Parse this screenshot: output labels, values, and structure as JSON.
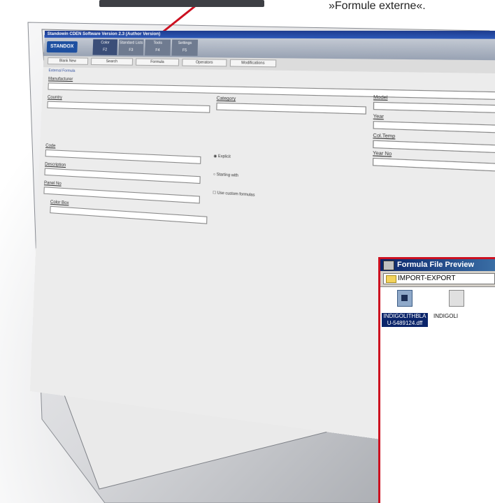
{
  "caption": "»Formule externe«.",
  "app": {
    "title_bar": "Standowin CDEN Software Version 2.3 (Author Version)",
    "logo": "STANDOX",
    "main_tabs": [
      {
        "label": "Color",
        "key": "F2"
      },
      {
        "label": "Standard Lists",
        "key": "F3"
      },
      {
        "label": "Tools",
        "key": "F4"
      },
      {
        "label": "Settings",
        "key": "F5"
      }
    ],
    "sub_tabs": [
      "Blank New",
      "Search",
      "Formula",
      "Operators",
      "Modifications"
    ],
    "breadcrumb": "External Formula",
    "form": {
      "manufacturer_label": "Manufacturer",
      "country_label": "Country",
      "category_label": "Category",
      "model_label": "Model",
      "year_label": "Year",
      "coltemp_label": "Col.Temp",
      "year_no_label": "Year No",
      "code_label": "Code",
      "description_label": "Description",
      "panel_no_label": "Panel No",
      "color_box_label": "Color Box",
      "opt_explicit": "Explicit",
      "opt_starting_with": "Starting with",
      "opt_use_custom": "Use custom formulas"
    }
  },
  "preview": {
    "title": "Formula File Preview",
    "path": "IMPORT-EXPORT",
    "files": [
      {
        "name": "INDIGOLITHBLAU-5489124.dff",
        "selected": true
      },
      {
        "name": "INDIGOLI",
        "selected": false
      }
    ]
  },
  "colors": {
    "highlight_red": "#cc1020",
    "title_blue": "#0a246a",
    "logo_blue": "#1d4fa0"
  }
}
